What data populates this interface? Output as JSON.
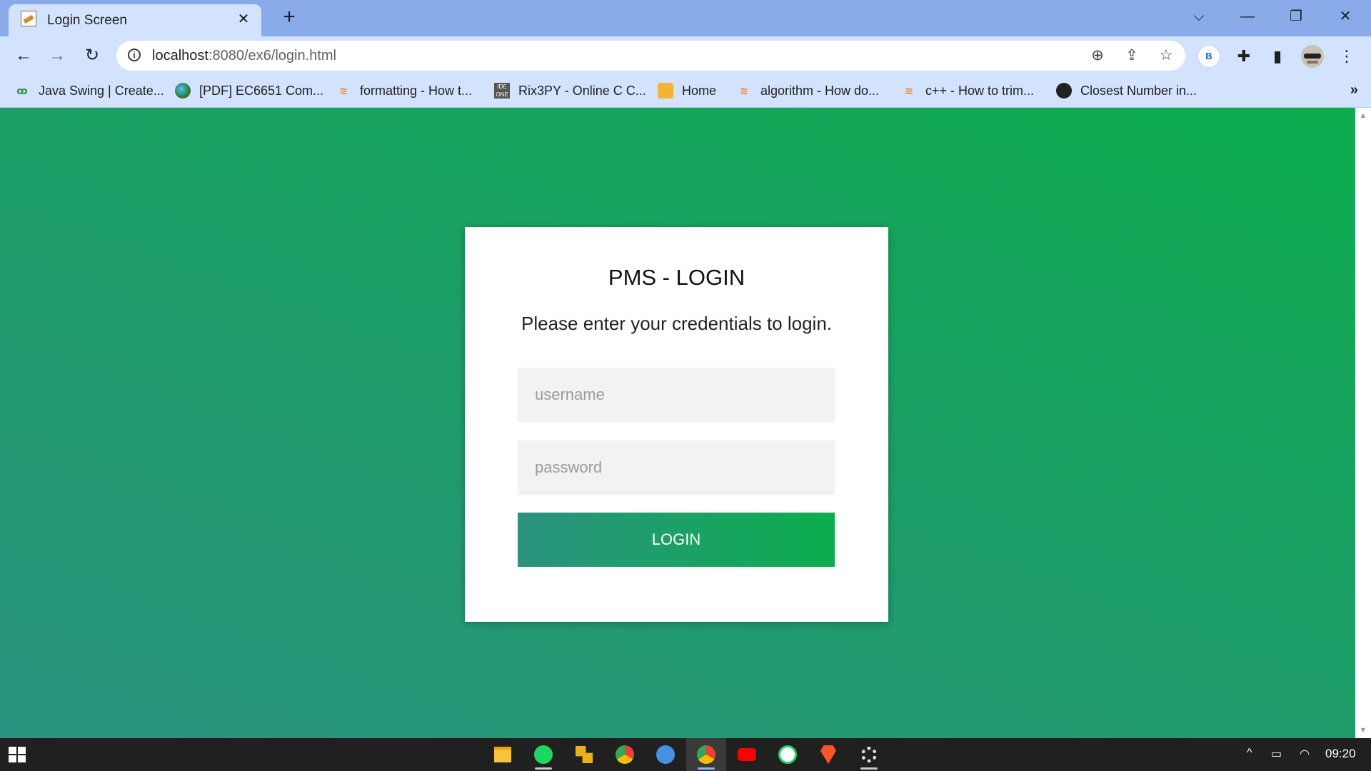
{
  "browser": {
    "tab": {
      "title": "Login Screen",
      "close": "✕",
      "favicon": "image-icon"
    },
    "new_tab": "+",
    "window_controls": {
      "list": "⌵",
      "minimize": "—",
      "restore": "❐",
      "close": "✕"
    },
    "nav": {
      "back": "←",
      "forward": "→",
      "reload": "↻"
    },
    "address": {
      "host": "localhost",
      "path": ":8080/ex6/login.html"
    },
    "omnibox_icons": {
      "zoom": "⊕",
      "share": "⇪",
      "bookmark_star": "☆"
    },
    "toolbar_icons": {
      "profile_letter": "B",
      "extensions": "✚",
      "sidepanel": "▮",
      "menu": "⋮"
    },
    "bookmarks": [
      {
        "label": "Java Swing | Create...",
        "icon": "geeksforgeeks-icon"
      },
      {
        "label": "[PDF] EC6651 Com...",
        "icon": "globe-color-icon"
      },
      {
        "label": "formatting - How t...",
        "icon": "stackoverflow-icon"
      },
      {
        "label": "Rix3PY - Online C C...",
        "icon": "ideone-icon"
      },
      {
        "label": "Home",
        "icon": "box-icon"
      },
      {
        "label": "algorithm - How do...",
        "icon": "stackoverflow-icon"
      },
      {
        "label": "c++ - How to trim...",
        "icon": "stackoverflow-icon"
      },
      {
        "label": "Closest Number in...",
        "icon": "globe-icon"
      }
    ],
    "bookmarks_overflow": "»"
  },
  "login": {
    "title": "PMS - LOGIN",
    "subtitle": "Please enter your credentials to login.",
    "username_placeholder": "username",
    "password_placeholder": "password",
    "button_label": "LOGIN"
  },
  "colors": {
    "gradient_start": "#2b937f",
    "gradient_end": "#0cad4e",
    "card_bg": "#ffffff",
    "field_bg": "#f2f2f2"
  },
  "taskbar": {
    "apps": [
      "file-explorer-icon",
      "spotify-icon",
      "app-icon",
      "chrome-icon",
      "spotify-blue-icon",
      "chrome-active-icon",
      "youtube-icon",
      "whatsapp-icon",
      "brave-icon",
      "settings-icon"
    ],
    "tray": {
      "chevron": "^",
      "network": "▭",
      "wifi": "◠"
    },
    "clock": "09:20"
  }
}
